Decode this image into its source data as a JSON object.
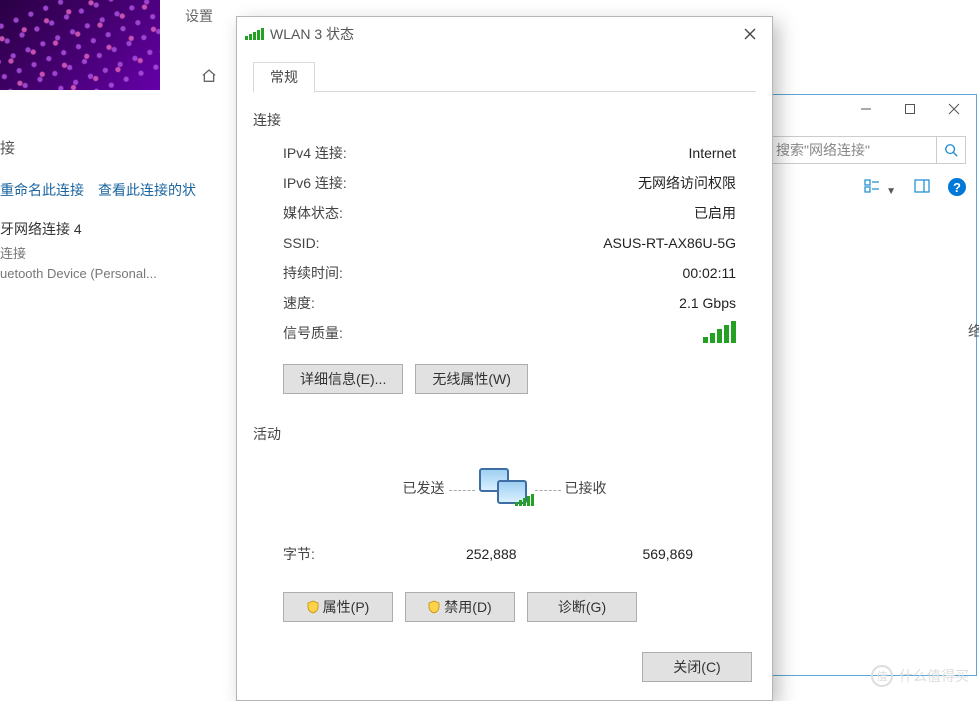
{
  "background": {
    "settings_label": "设置",
    "connections_heading": "接",
    "toolbar_rename": "重命名此连接",
    "toolbar_view": "查看此连接的状",
    "item1_name": "牙网络连接 4",
    "item1_sub1": "连接",
    "item1_sub2": "uetooth Device (Personal..."
  },
  "explorer": {
    "search_placeholder": "搜索\"网络连接\"",
    "side_label": "络"
  },
  "dialog": {
    "title": "WLAN 3 状态",
    "tab_general": "常规",
    "section_connection": "连接",
    "rows": {
      "ipv4_label": "IPv4 连接:",
      "ipv4_value": "Internet",
      "ipv6_label": "IPv6 连接:",
      "ipv6_value": "无网络访问权限",
      "media_label": "媒体状态:",
      "media_value": "已启用",
      "ssid_label": "SSID:",
      "ssid_value": "ASUS-RT-AX86U-5G",
      "duration_label": "持续时间:",
      "duration_value": "00:02:11",
      "speed_label": "速度:",
      "speed_value": "2.1 Gbps",
      "quality_label": "信号质量:"
    },
    "btn_details": "详细信息(E)...",
    "btn_wireless": "无线属性(W)",
    "section_activity": "活动",
    "activity": {
      "sent_label": "已发送",
      "recv_label": "已接收",
      "bytes_label": "字节:",
      "sent_bytes": "252,888",
      "recv_bytes": "569,869"
    },
    "btn_properties": "属性(P)",
    "btn_disable": "禁用(D)",
    "btn_diagnose": "诊断(G)",
    "btn_close": "关闭(C)"
  },
  "watermark": "什么值得买"
}
